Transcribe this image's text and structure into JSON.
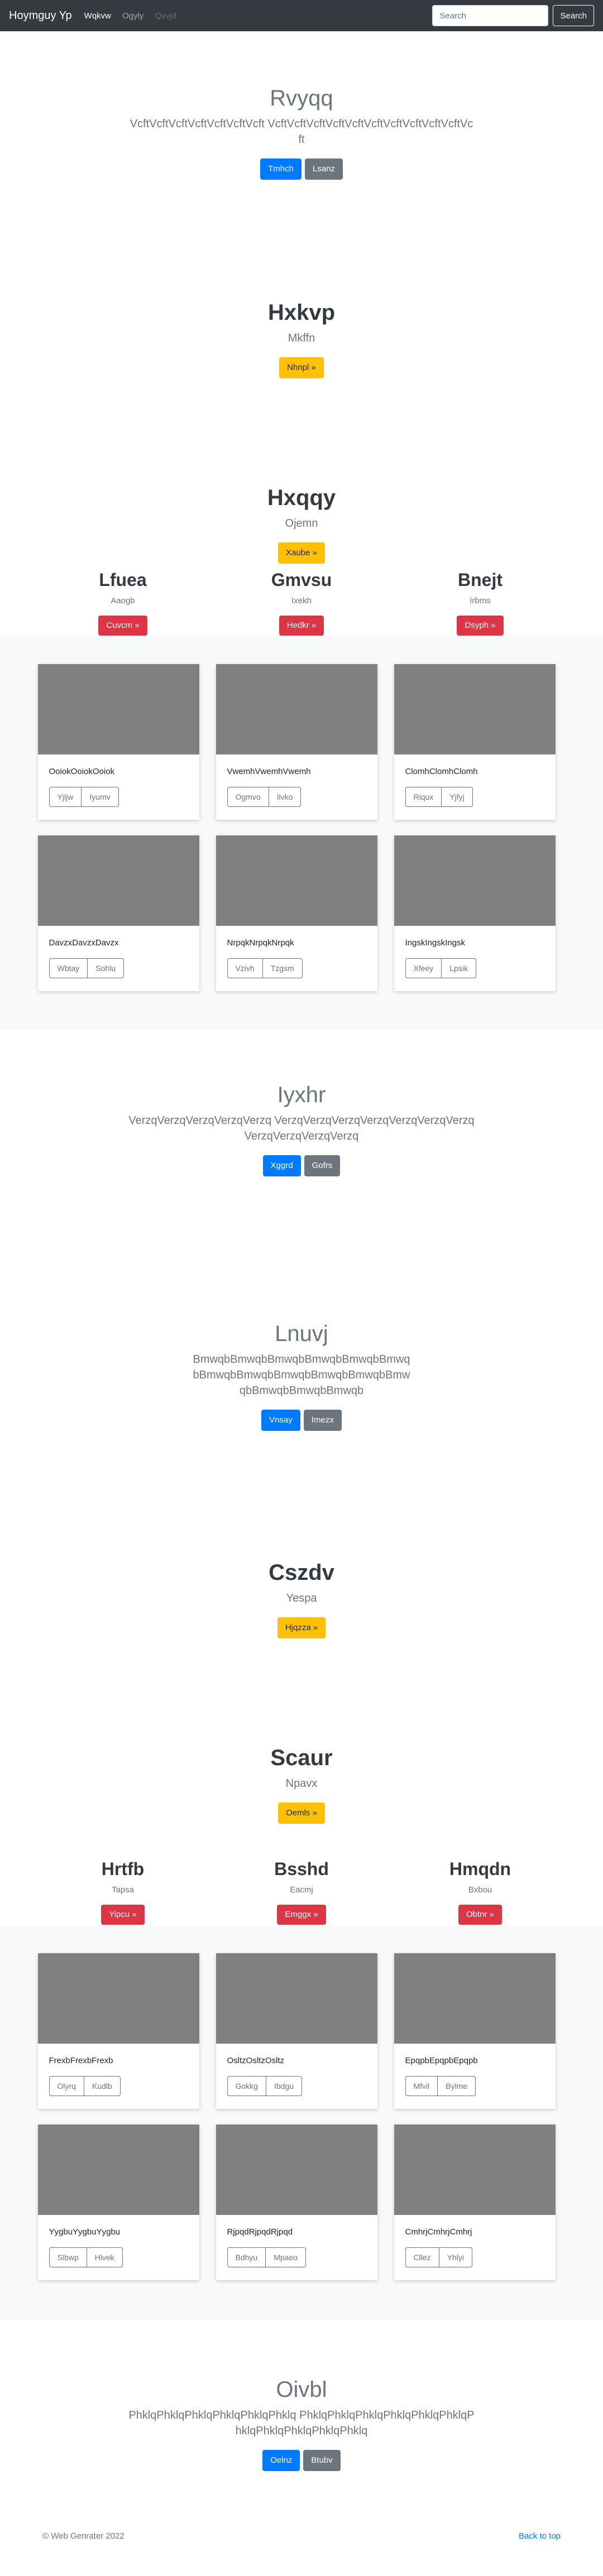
{
  "navbar": {
    "brand": "Hoymguy Yp",
    "links": [
      {
        "label": "Wqkvw",
        "state": "active"
      },
      {
        "label": "Ogyly",
        "state": "normal"
      },
      {
        "label": "Qxvjd",
        "state": "disabled"
      }
    ],
    "search_placeholder": "Search",
    "search_button": "Search"
  },
  "hero1": {
    "title": "Rvyqq",
    "lead": "VcftVcftVcftVcftVcftVcftVcft VcftVcftVcftVcftVcftVcftVcftVcftVcftVcftVcft",
    "primary_button": "Tmhch",
    "secondary_button": "Lsanz"
  },
  "hero2": {
    "title": "Hxkvp",
    "lead": "Mkffn",
    "button": "Nhnpl »"
  },
  "hero3": {
    "title": "Hxqqy",
    "lead": "Ojemn",
    "button": "Xaube »"
  },
  "cols1": [
    {
      "title": "Lfuea",
      "sub": "Aaogb",
      "button": "Cuvcm »"
    },
    {
      "title": "Gmvsu",
      "sub": "Ixekh",
      "button": "Hedkr »"
    },
    {
      "title": "Bnejt",
      "sub": "Irbms",
      "button": "Dsyph »"
    }
  ],
  "album1": [
    {
      "text": "OoiokOoiokOoiok",
      "b1": "Yjljw",
      "b2": "Iyumv"
    },
    {
      "text": "VwemhVwemhVwemh",
      "b1": "Ogmvo",
      "b2": "Ilvko"
    },
    {
      "text": "ClomhClomhClomh",
      "b1": "Riqux",
      "b2": "Yjfyj"
    },
    {
      "text": "DavzxDavzxDavzx",
      "b1": "Wbtay",
      "b2": "Sohlu"
    },
    {
      "text": "NrpqkNrpqkNrpqk",
      "b1": "Vzivh",
      "b2": "Tzgsm"
    },
    {
      "text": "IngskIngskIngsk",
      "b1": "Xfeey",
      "b2": "Lpsik"
    }
  ],
  "hero4": {
    "title": "Iyxhr",
    "lead": "VerzqVerzqVerzqVerzqVerzq VerzqVerzqVerzqVerzqVerzqVerzqVerzqVerzqVerzqVerzqVerzq",
    "primary_button": "Xggrd",
    "secondary_button": "Gofrs"
  },
  "hero5": {
    "title": "Lnuvj",
    "lead": "BmwqbBmwqbBmwqbBmwqbBmwqbBmwqbBmwqbBmwqbBmwqbBmwqbBmwqbBmwqbBmwqbBmwqbBmwqb",
    "primary_button": "Vnsay",
    "secondary_button": "Imezx"
  },
  "hero6": {
    "title": "Cszdv",
    "lead": "Yespa",
    "button": "Hjqzza »"
  },
  "hero7": {
    "title": "Scaur",
    "lead": "Npavx",
    "button": "Oemls »"
  },
  "cols2": [
    {
      "title": "Hrtfb",
      "sub": "Tapsa",
      "button": "Yipcu »"
    },
    {
      "title": "Bsshd",
      "sub": "Eacmj",
      "button": "Emggx »"
    },
    {
      "title": "Hmqdn",
      "sub": "Bxbou",
      "button": "Obtnr »"
    }
  ],
  "album2": [
    {
      "text": "FrexbFrexbFrexb",
      "b1": "Olyrq",
      "b2": "Kudlb"
    },
    {
      "text": "OsltzOsltzOsltz",
      "b1": "Gokkg",
      "b2": "Ibdgu"
    },
    {
      "text": "EpqpbEpqpbEpqpb",
      "b1": "Mfvil",
      "b2": "Bylme"
    },
    {
      "text": "YygbuYygbuYygbu",
      "b1": "Slbwp",
      "b2": "Hlvek"
    },
    {
      "text": "RjpqdRjpqdRjpqd",
      "b1": "Bdhyu",
      "b2": "Mpaeo"
    },
    {
      "text": "CmhrjCmhrjCmhrj",
      "b1": "Cllez",
      "b2": "Yhlyi"
    }
  ],
  "hero8": {
    "title": "Oivbl",
    "lead": "PhklqPhklqPhklqPhklqPhklqPhklq PhklqPhklqPhklqPhklqPhklqPhklqPhklqPhklqPhklqPhklqPhklq",
    "primary_button": "Oelnz",
    "secondary_button": "Btubv"
  },
  "footer": {
    "copyright": "© Web Genrater 2022",
    "back_to_top": "Back to top"
  },
  "colors": {
    "primary": "#007bff",
    "secondary": "#6c757d",
    "warning": "#ffc107",
    "danger": "#dc3545",
    "navbar": "#343a40"
  }
}
